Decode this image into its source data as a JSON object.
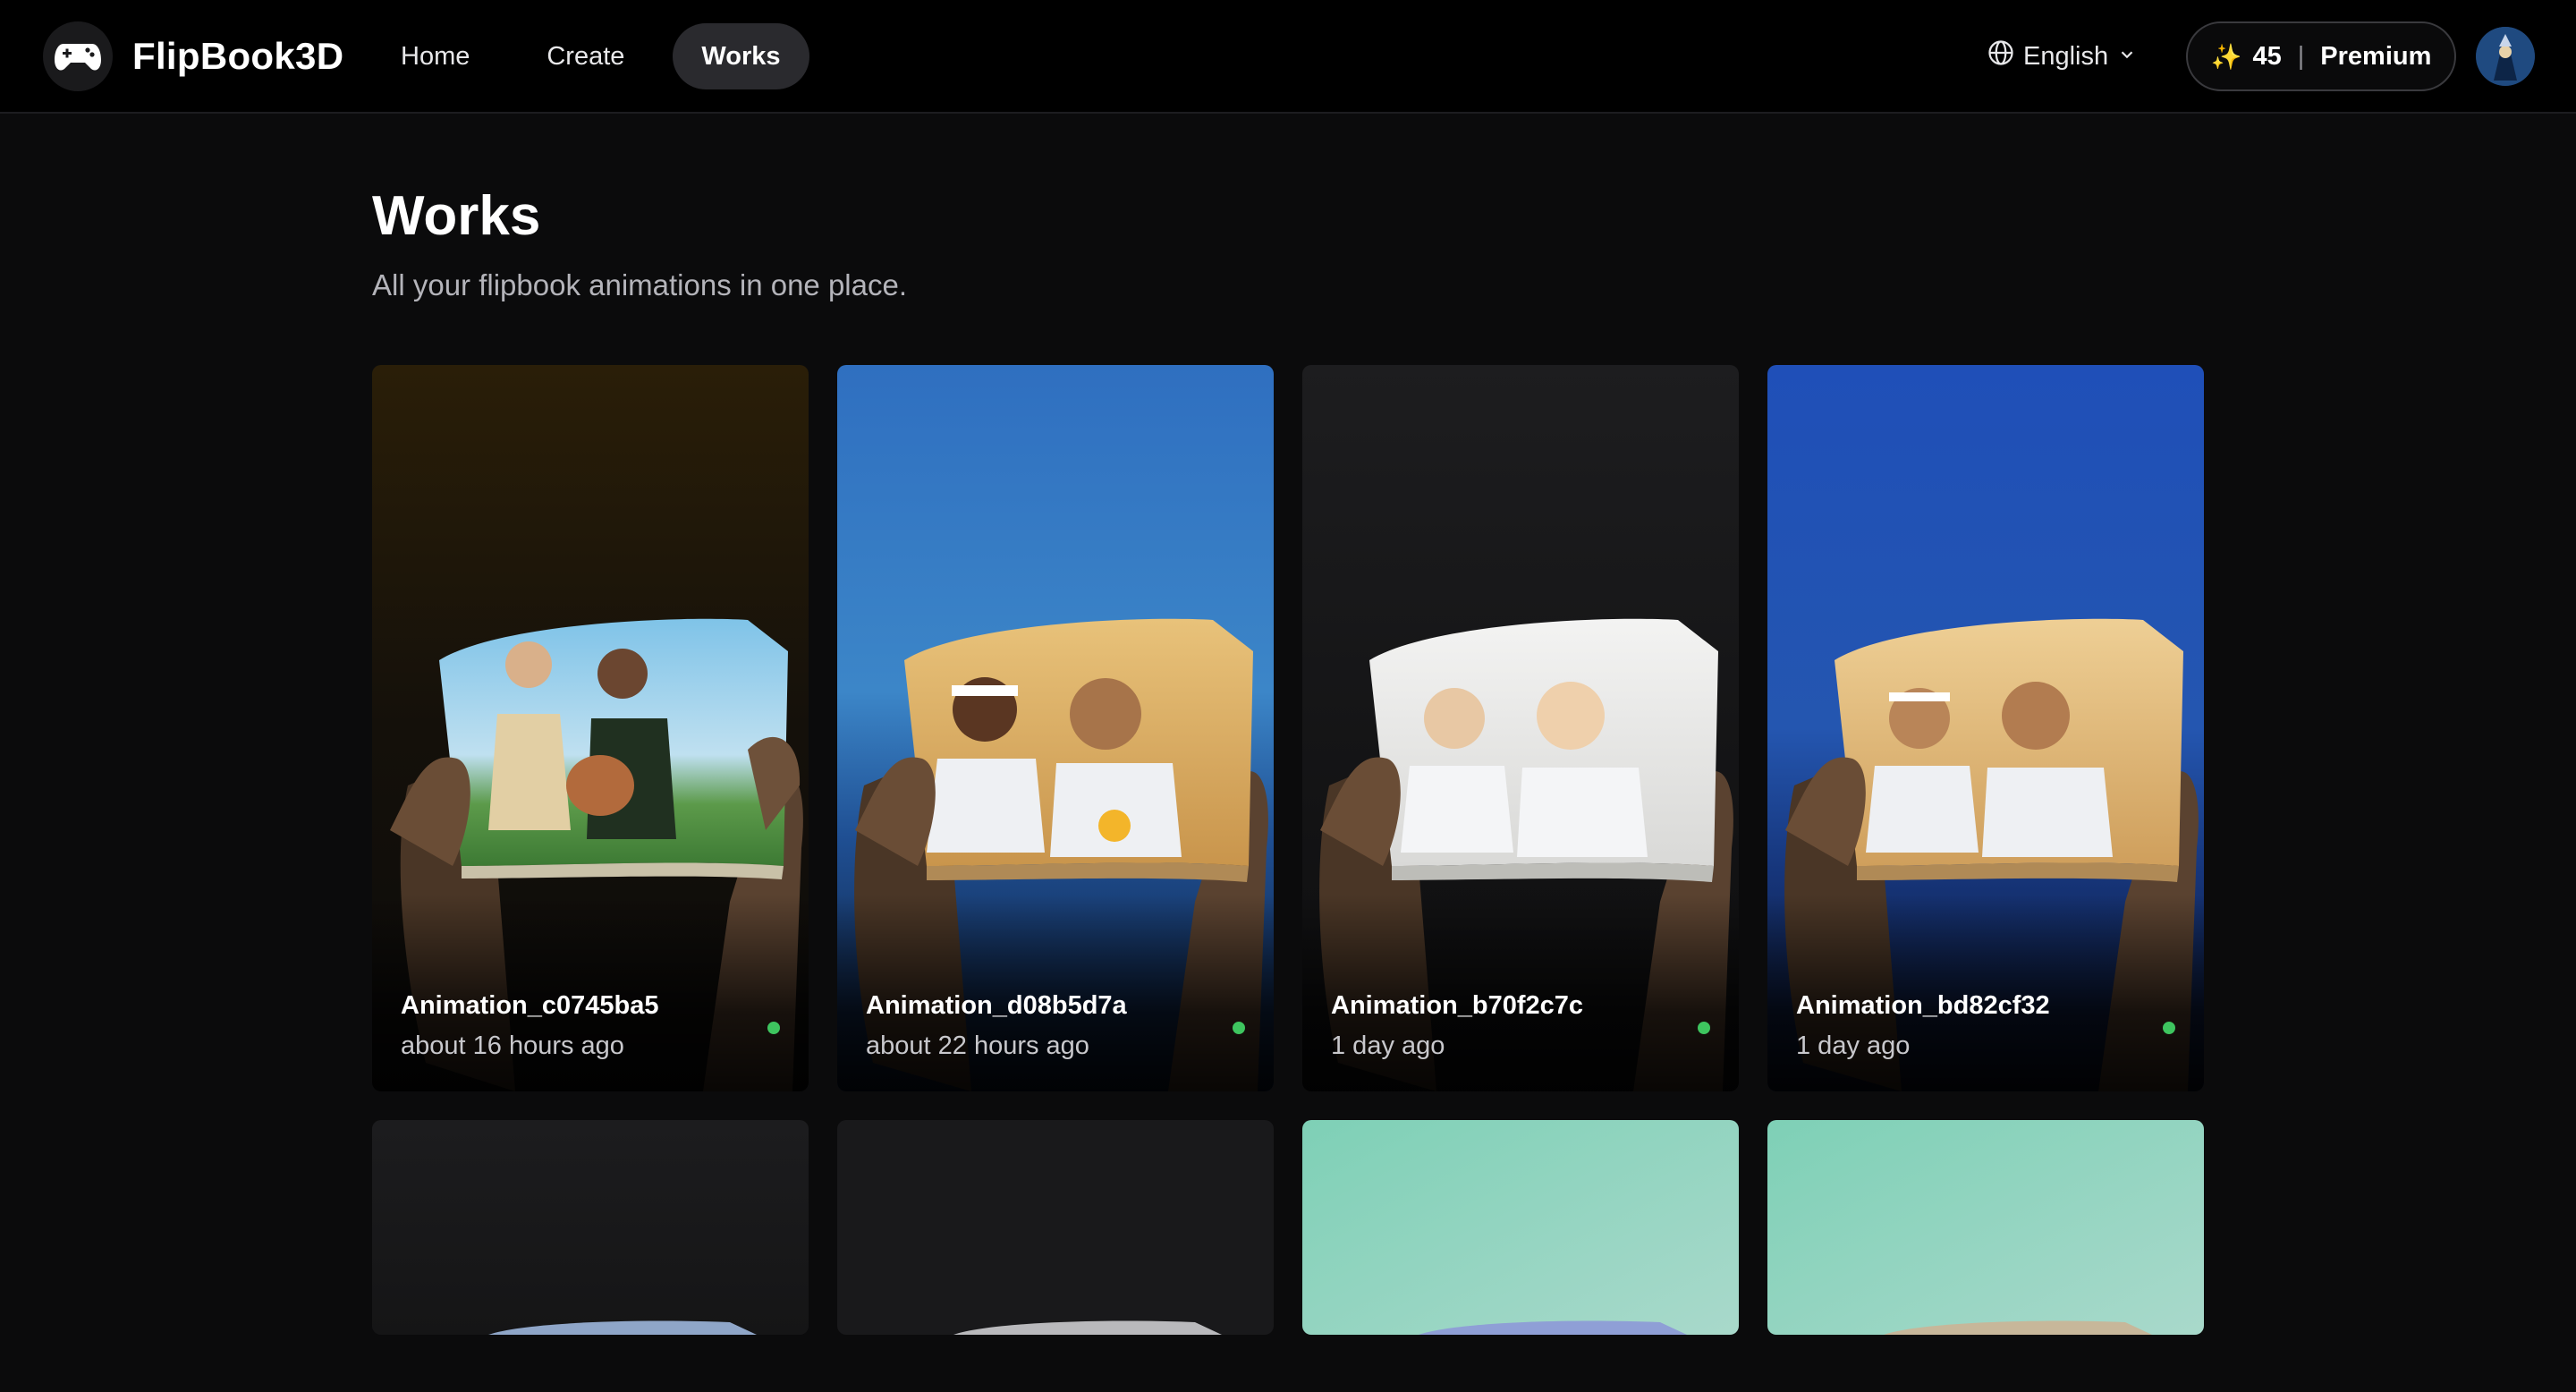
{
  "app": {
    "name": "FlipBook3D",
    "logo_icon": "gamepad-icon"
  },
  "nav": {
    "items": [
      {
        "label": "Home",
        "active": false
      },
      {
        "label": "Create",
        "active": false
      },
      {
        "label": "Works",
        "active": true
      }
    ]
  },
  "language": {
    "label": "English",
    "icon": "globe-icon"
  },
  "account": {
    "credits": "45",
    "plan": "Premium",
    "credits_icon": "sparkle-icon"
  },
  "page": {
    "title": "Works",
    "subtitle": "All your flipbook animations in one place."
  },
  "works": [
    {
      "title": "Animation_c0745ba5",
      "time": "about 16 hours ago",
      "status": "ready",
      "status_color": "#3ec55f"
    },
    {
      "title": "Animation_d08b5d7a",
      "time": "about 22 hours ago",
      "status": "ready",
      "status_color": "#3ec55f"
    },
    {
      "title": "Animation_b70f2c7c",
      "time": "1 day ago",
      "status": "ready",
      "status_color": "#3ec55f"
    },
    {
      "title": "Animation_bd82cf32",
      "time": "1 day ago",
      "status": "ready",
      "status_color": "#3ec55f"
    }
  ],
  "colors": {
    "background": "#0b0b0c",
    "header": "#000000",
    "accent_sparkle": "#f6c744",
    "status_ready": "#3ec55f"
  }
}
